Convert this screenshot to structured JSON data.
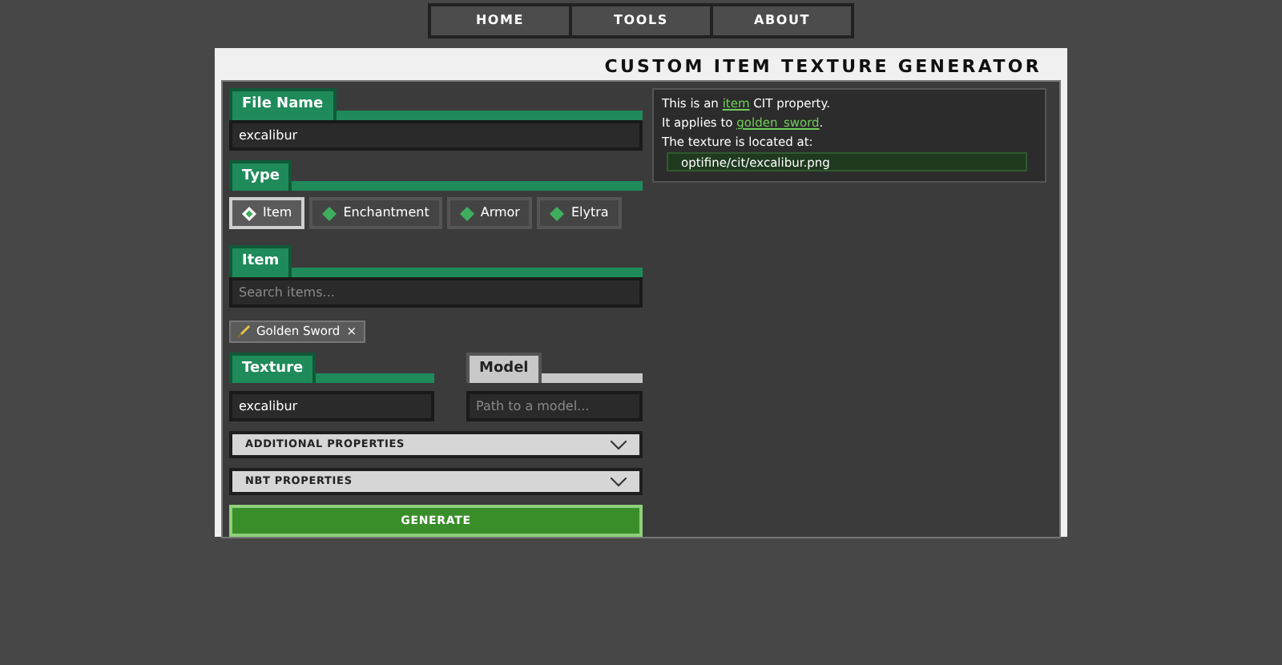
{
  "nav": [
    {
      "label": "HOME"
    },
    {
      "label": "TOOLS"
    },
    {
      "label": "ABOUT"
    }
  ],
  "title": "CUSTOM ITEM TEXTURE GENERATOR",
  "file_name": {
    "label": "File Name",
    "value": "excalibur"
  },
  "type": {
    "label": "Type",
    "options": [
      {
        "label": "Item",
        "selected": true
      },
      {
        "label": "Enchantment",
        "selected": false
      },
      {
        "label": "Armor",
        "selected": false
      },
      {
        "label": "Elytra",
        "selected": false
      }
    ]
  },
  "item": {
    "label": "Item",
    "placeholder": "Search items...",
    "chips": [
      {
        "label": "Golden Sword",
        "remove": "×"
      }
    ]
  },
  "texture": {
    "label": "Texture",
    "value": "excalibur",
    "enabled": true
  },
  "model": {
    "label": "Model",
    "placeholder": "Path to a model...",
    "enabled": false
  },
  "sections": [
    {
      "label": "ADDITIONAL PROPERTIES",
      "expanded": false
    },
    {
      "label": "NBT PROPERTIES",
      "expanded": false
    }
  ],
  "generate": "GENERATE",
  "info": {
    "lines": [
      {
        "before": "This is an ",
        "link": "item",
        "after": " CIT property."
      },
      {
        "before": "It applies to ",
        "link": "golden_sword",
        "after": "."
      },
      {
        "before": "The texture is located at:"
      }
    ],
    "path": "optifine/cit/excalibur.png"
  }
}
